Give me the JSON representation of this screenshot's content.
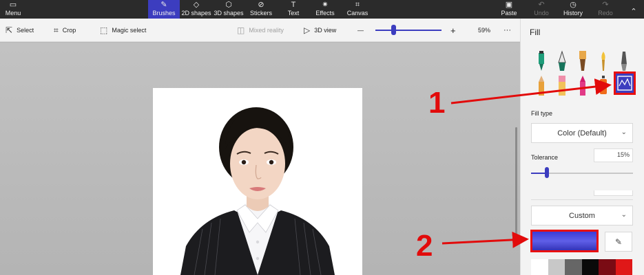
{
  "topbar": {
    "menu_label": "Menu",
    "tools": [
      {
        "label": "Brushes",
        "icon": "brush-icon"
      },
      {
        "label": "2D shapes",
        "icon": "shapes-2d-icon"
      },
      {
        "label": "3D shapes",
        "icon": "cube-icon"
      },
      {
        "label": "Stickers",
        "icon": "sticker-icon"
      },
      {
        "label": "Text",
        "icon": "text-icon"
      },
      {
        "label": "Effects",
        "icon": "sun-icon"
      },
      {
        "label": "Canvas",
        "icon": "canvas-icon"
      }
    ],
    "active_tool": "Brushes",
    "paste_label": "Paste",
    "undo_label": "Undo",
    "history_label": "History",
    "redo_label": "Redo"
  },
  "toolbar": {
    "select_label": "Select",
    "crop_label": "Crop",
    "magic_select_label": "Magic select",
    "mixed_reality_label": "Mixed reality",
    "view3d_label": "3D view",
    "zoom_minus": "—",
    "zoom_plus": "+",
    "zoom_value": "59%",
    "more_label": "···"
  },
  "panel": {
    "title": "Fill",
    "fill_type_label": "Fill type",
    "fill_type_value": "Color (Default)",
    "tolerance_label": "Tolerance",
    "tolerance_value": "15%",
    "tolerance_level": 0.15,
    "color_mode_value": "Custom",
    "selected_color": "#4a4ae0",
    "palette": [
      "#ffffff",
      "#c8c8c8",
      "#666666",
      "#0a0a0a",
      "#7a0b14",
      "#e01818"
    ]
  },
  "annotations": {
    "one": "1",
    "two": "2"
  },
  "colors": {
    "accent": "#3c3dbf",
    "annotation_red": "#e20b0b"
  }
}
